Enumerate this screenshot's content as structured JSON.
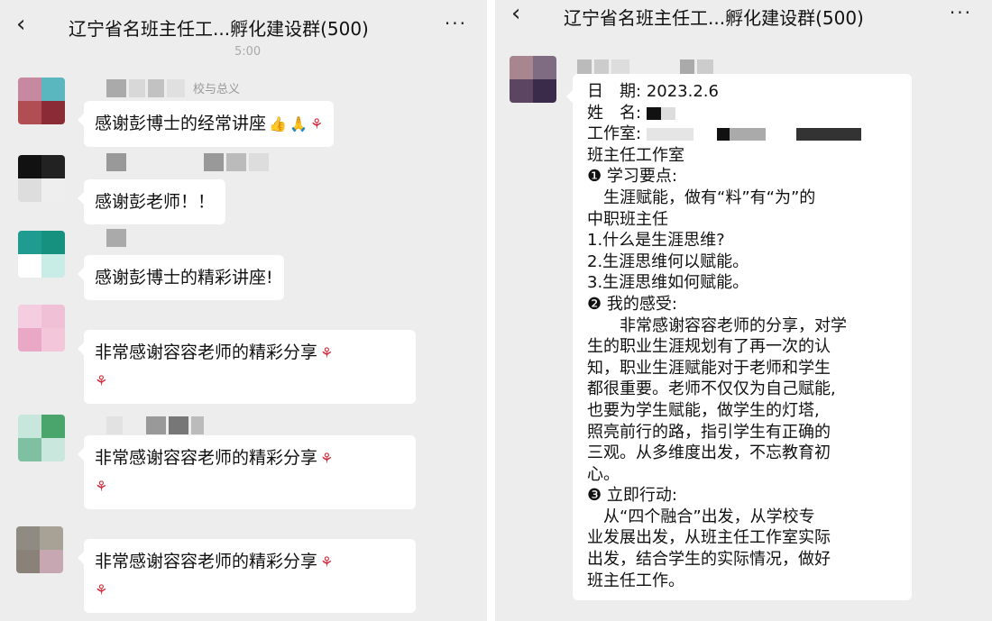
{
  "left_panel": {
    "header": {
      "back_icon": "‹",
      "title": "辽宁省名班主任工...孵化建设群(500)",
      "more_icon": "···"
    },
    "time_fragment": "5:00",
    "messages": [
      {
        "sender_fragment": "校与总义",
        "text": "感谢彭博士的经常讲座",
        "emoji": [
          "thumbs-up",
          "praying-hands",
          "rose"
        ]
      },
      {
        "sender_fragment": "",
        "text": "感谢彭老师！！",
        "emoji": []
      },
      {
        "sender_fragment": "",
        "text": "感谢彭博士的精彩讲座!",
        "emoji": []
      },
      {
        "sender_fragment": "",
        "text": "非常感谢容容老师的精彩分享",
        "emoji": [
          "rose",
          "rose"
        ]
      },
      {
        "sender_fragment": "",
        "text": "非常感谢容容老师的精彩分享",
        "emoji": [
          "rose",
          "rose"
        ]
      },
      {
        "sender_fragment": "",
        "text": "非常感谢容容老师的精彩分享",
        "emoji": [
          "rose",
          "rose"
        ]
      }
    ]
  },
  "right_panel": {
    "header": {
      "back_icon": "‹",
      "title": "辽宁省名班主任工...孵化建设群(500)",
      "more_icon": "···"
    },
    "document": {
      "date_label": "日　期:",
      "date_value": "2023.2.6",
      "name_label": "姓　名:",
      "studio_label": "工作室:",
      "studio_line2": "班主任工作室",
      "section1_heading": "❶ 学习要点:",
      "section1_lines": [
        "　生涯赋能，做有“料”有“为”的",
        "中职班主任",
        "1.什么是生涯思维?",
        "2.生涯思维何以赋能。",
        "3.生涯思维如何赋能。"
      ],
      "section2_heading": "❷ 我的感受:",
      "section2_lines": [
        "　　非常感谢容容老师的分享，对学",
        "生的职业生涯规划有了再一次的认",
        "知，职业生涯赋能对于老师和学生",
        "都很重要。老师不仅仅为自己赋能,",
        "也要为学生赋能，做学生的灯塔,",
        "照亮前行的路，指引学生有正确的",
        "三观。从多维度出发，不忘教育初",
        "心。"
      ],
      "section3_heading": "❸ 立即行动:",
      "section3_lines": [
        "　从“四个融合”出发，从学校专",
        "业发展出发，从班主任工作室实际",
        "出发，结合学生的实际情况，做好",
        "班主任工作。"
      ]
    }
  },
  "colors": {
    "background": "#ededed",
    "bubble": "#ffffff",
    "text": "#111111",
    "rose": "#d4283a"
  }
}
